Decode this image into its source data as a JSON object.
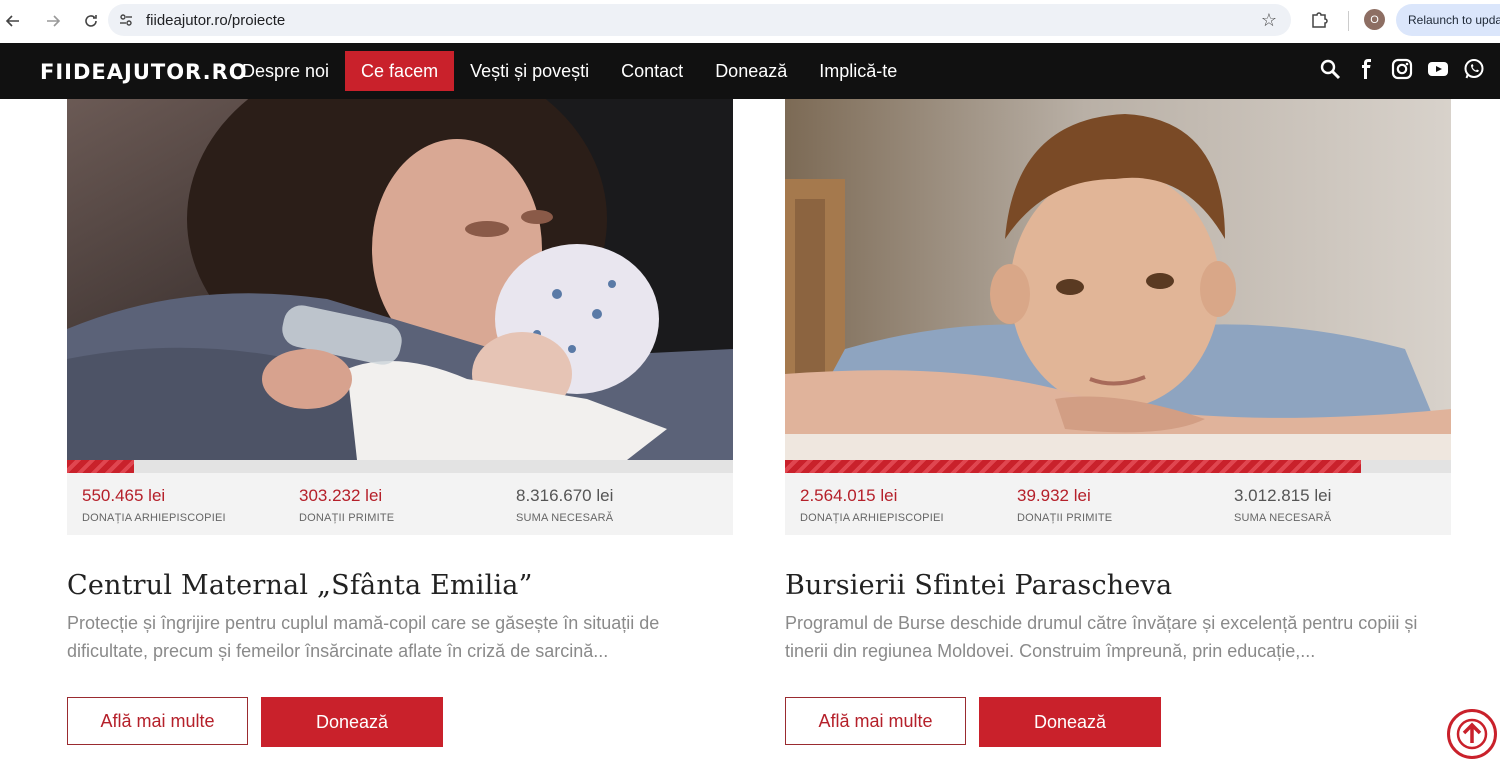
{
  "browser": {
    "url": "fiideajutor.ro/proiecte",
    "profile_initial": "O",
    "relaunch_label": "Relaunch to upda"
  },
  "site": {
    "logo": "FIIDEAJUTOR.RO",
    "menu": [
      {
        "label": "Despre noi",
        "active": false
      },
      {
        "label": "Ce facem",
        "active": true
      },
      {
        "label": "Vești și povești",
        "active": false
      },
      {
        "label": "Contact",
        "active": false
      },
      {
        "label": "Donează",
        "active": false
      },
      {
        "label": "Implică-te",
        "active": false
      }
    ],
    "social_icons": [
      "search-icon",
      "facebook-icon",
      "instagram-icon",
      "youtube-icon",
      "whatsapp-icon"
    ],
    "accent_color": "#c9212b"
  },
  "projects": [
    {
      "progress": 0.1,
      "stats": [
        {
          "value": "550.465 lei",
          "label": "DONAȚIA ARHIEPISCOPIEI"
        },
        {
          "value": "303.232 lei",
          "label": "DONAȚII PRIMITE"
        },
        {
          "value": "8.316.670 lei",
          "label": "SUMA NECESARĂ"
        }
      ],
      "title": "Centrul Maternal „Sfânta Emilia”",
      "description": "Protecție și îngrijire pentru cuplul mamă-copil care se găsește în situații de dificultate, precum și femeilor însărcinate aflate în criză de sarcină...",
      "learn_more": "Află mai multe",
      "donate": "Donează"
    },
    {
      "progress": 0.865,
      "stats": [
        {
          "value": "2.564.015 lei",
          "label": "DONAȚIA ARHIEPISCOPIEI"
        },
        {
          "value": "39.932 lei",
          "label": "DONAȚII PRIMITE"
        },
        {
          "value": "3.012.815 lei",
          "label": "SUMA NECESARĂ"
        }
      ],
      "title": "Bursierii Sfintei Parascheva",
      "description": "Programul de Burse deschide drumul către învățare și excelență pentru copiii și tinerii din regiunea Moldovei. Construim împreună, prin educație,...",
      "learn_more": "Află mai multe",
      "donate": "Donează"
    }
  ]
}
